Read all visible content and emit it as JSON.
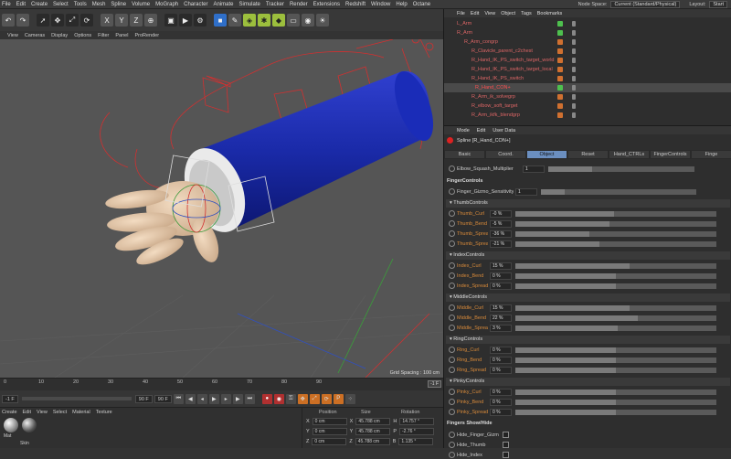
{
  "menubar": {
    "items": [
      "File",
      "Edit",
      "Create",
      "Select",
      "Tools",
      "Mesh",
      "Spline",
      "Volume",
      "MoGraph",
      "Character",
      "Animate",
      "Simulate",
      "Tracker",
      "Render",
      "Extensions",
      "Redshift",
      "Window",
      "Help",
      "Octane"
    ],
    "node_space_label": "Node Space:",
    "node_space_value": "Current (Standard/Physical)",
    "layout_label": "Layout:",
    "layout_value": "Start"
  },
  "viewport_menu": [
    "View",
    "Cameras",
    "Display",
    "Options",
    "Filter",
    "Panel",
    "ProRender"
  ],
  "viewport": {
    "grid_spacing": "Grid Spacing : 100 cm"
  },
  "timeline": {
    "ticks": [
      "0",
      "10",
      "20",
      "30",
      "40",
      "50",
      "60",
      "70",
      "80",
      "90"
    ],
    "frame_indicator": "-1 F"
  },
  "transport": {
    "start": "-1 F",
    "end": "90 F",
    "end2": "90 F"
  },
  "material": {
    "menu": [
      "Create",
      "Edit",
      "View",
      "Select",
      "Material",
      "Texture"
    ],
    "mats": [
      "Mat",
      "Skin"
    ]
  },
  "coords": {
    "headers": [
      "Position",
      "Size",
      "Rotation"
    ],
    "rows": [
      {
        "axis": "X",
        "pos": "0 cm",
        "size_axis": "X",
        "size": "45.788 cm",
        "rot_axis": "H",
        "rot": "14.757 °"
      },
      {
        "axis": "Y",
        "pos": "0 cm",
        "size_axis": "Y",
        "size": "45.788 cm",
        "rot_axis": "P",
        "rot": "-2.76 °"
      },
      {
        "axis": "Z",
        "pos": "0 cm",
        "size_axis": "Z",
        "size": "45.788 cm",
        "rot_axis": "B",
        "rot": "1.135 °"
      }
    ]
  },
  "objects": {
    "menu": [
      "File",
      "Edit",
      "View",
      "Object",
      "Tags",
      "Bookmarks"
    ],
    "rows": [
      {
        "name": "L_Arm",
        "color": "#4ec04e"
      },
      {
        "name": "R_Arm",
        "color": "#4ec04e"
      },
      {
        "name": "R_Arm_congrp",
        "color": "#d07030"
      },
      {
        "name": "R_Clavicle_parent_c2chest",
        "color": "#d07030"
      },
      {
        "name": "R_Hand_IK_PS_switch_target_world",
        "color": "#d07030"
      },
      {
        "name": "R_Hand_IK_PS_switch_target_local",
        "color": "#d07030"
      },
      {
        "name": "R_Hand_IK_PS_switch",
        "color": "#d07030"
      },
      {
        "name": "R_Hand_CON+",
        "color": "#4ec04e"
      },
      {
        "name": "R_Arm_ik_solvegrp",
        "color": "#d07030"
      },
      {
        "name": "R_elbow_soft_target",
        "color": "#d07030"
      },
      {
        "name": "R_Arm_ikfk_blendgrp",
        "color": "#d07030"
      }
    ]
  },
  "attributes": {
    "menu": [
      "Mode",
      "Edit",
      "User Data"
    ],
    "title": "Spline [R_Hand_CON+]",
    "tabs": [
      "Basic",
      "Coord.",
      "Object",
      "Reset",
      "Hand_CTRLs",
      "FingerControls",
      "Finge"
    ],
    "elbow": {
      "label": "Elbow_Squash_Multiplier",
      "value": "1"
    },
    "finger_controls": {
      "header": "FingerControls",
      "label": "Finger_Gizmo_Sensitivity",
      "value": "1"
    },
    "sections": [
      {
        "title": "ThumbControls",
        "rows": [
          {
            "label": "Thumb_Curl",
            "value": "-0 %",
            "fill": 0.49
          },
          {
            "label": "Thumb_Bend",
            "value": "-5 %",
            "fill": 0.47
          },
          {
            "label": "Thumb_Spread_y",
            "value": "-36 %",
            "fill": 0.37
          },
          {
            "label": "Thumb_Spread_z",
            "value": "-21 %",
            "fill": 0.42
          }
        ]
      },
      {
        "title": "IndexControls",
        "rows": [
          {
            "label": "Index_Curl",
            "value": "15 %",
            "fill": 0.57
          },
          {
            "label": "Index_Bend",
            "value": "0 %",
            "fill": 0.5
          },
          {
            "label": "Index_Spread",
            "value": "0 %",
            "fill": 0.5
          }
        ]
      },
      {
        "title": "MiddleControls",
        "rows": [
          {
            "label": "Middle_Curl",
            "value": "15 %",
            "fill": 0.57
          },
          {
            "label": "Middle_Bend",
            "value": "22 %",
            "fill": 0.61
          },
          {
            "label": "Middle_Spread",
            "value": "3 %",
            "fill": 0.51
          }
        ]
      },
      {
        "title": "RingControls",
        "rows": [
          {
            "label": "Ring_Curl",
            "value": "0 %",
            "fill": 0.5
          },
          {
            "label": "Ring_Bend",
            "value": "0 %",
            "fill": 0.5
          },
          {
            "label": "Ring_Spread",
            "value": "0 %",
            "fill": 0.5
          }
        ]
      },
      {
        "title": "PinkyControls",
        "rows": [
          {
            "label": "Pinky_Curl",
            "value": "0 %",
            "fill": 0.5
          },
          {
            "label": "Pinky_Bend",
            "value": "0 %",
            "fill": 0.5
          },
          {
            "label": "Pinky_Spread",
            "value": "0 %",
            "fill": 0.5
          }
        ]
      }
    ],
    "show_hide": {
      "header": "Fingers Show/Hide",
      "items": [
        "Hide_Finger_Gizmo",
        "Hide_Thumb",
        "Hide_Index"
      ]
    }
  }
}
